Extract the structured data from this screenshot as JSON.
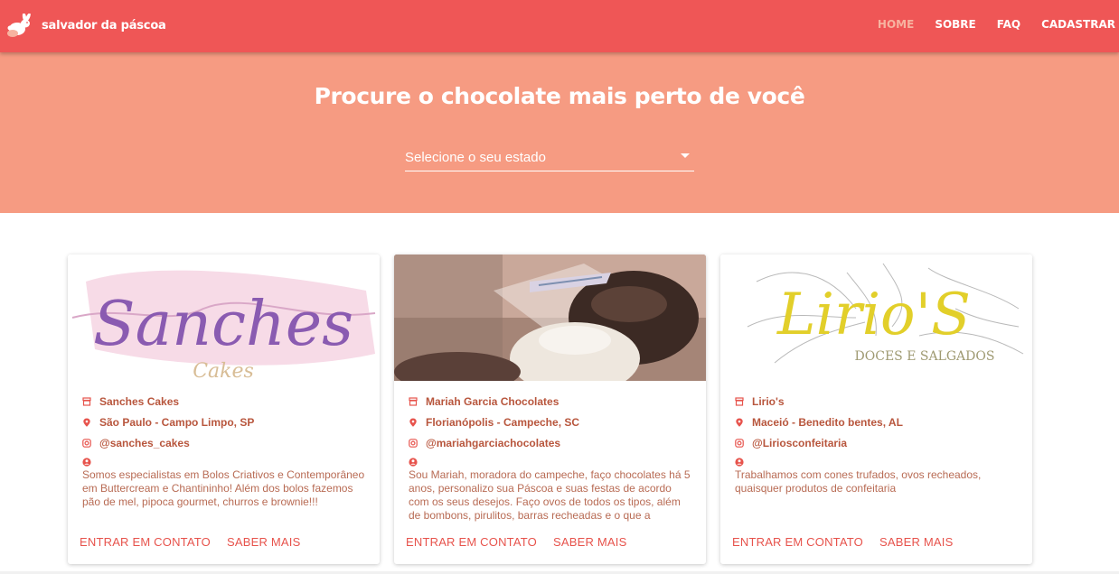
{
  "brand": {
    "name": "salvador da páscoa",
    "icon": "bunny-icon"
  },
  "nav": [
    {
      "label": "HOME",
      "active": true
    },
    {
      "label": "SOBRE",
      "active": false
    },
    {
      "label": "FAQ",
      "active": false
    },
    {
      "label": "CADASTRAR",
      "active": false
    }
  ],
  "hero": {
    "title": "Procure o chocolate mais perto de você",
    "select_placeholder": "Selecione o seu estado"
  },
  "cards": [
    {
      "logo_title": "Sanches",
      "logo_subtitle": "Cakes",
      "name": "Sanches Cakes",
      "location": "São Paulo - Campo Limpo, SP",
      "instagram": "@sanches_cakes",
      "description": "Somos especialistas em Bolos Criativos e Contemporâneo em Buttercream e Chantininho! Além dos bolos fazemos pão de mel, pipoca gourmet, churros e brownie!!!",
      "contact_label": "ENTRAR EM CONTATO",
      "more_label": "SABER MAIS"
    },
    {
      "name": "Mariah Garcia Chocolates",
      "location": "Florianópolis - Campeche, SC",
      "instagram": "@mariahgarciachocolates",
      "description": "Sou Mariah, moradora do campeche, faço chocolates há 5 anos, personalizo sua Páscoa e suas festas de acordo com os seus desejos. Faço ovos de todos os tipos, além de bombons, pirulitos, barras recheadas e o que a imaginação",
      "contact_label": "ENTRAR EM CONTATO",
      "more_label": "SABER MAIS"
    },
    {
      "logo_title": "Lirio'S",
      "logo_subtitle": "DOCES E SALGADOS",
      "name": "Lirio's",
      "location": "Maceió - Benedito bentes, AL",
      "instagram": "@Liriosconfeitaria",
      "description": "Trabalhamos com cones trufados, ovos recheados, quaisquer produtos de confeitaria",
      "contact_label": "ENTRAR EM CONTATO",
      "more_label": "SABER MAIS"
    }
  ],
  "colors": {
    "navbar": "#ef5656",
    "hero": "#f69b82",
    "accent_text": "#b8563d",
    "button": "#e7534c",
    "nav_active": "#f7b3a0"
  },
  "icons": {
    "store": "store-icon",
    "location": "location-pin-icon",
    "instagram": "instagram-icon",
    "person": "person-icon",
    "caret": "chevron-down-icon"
  }
}
